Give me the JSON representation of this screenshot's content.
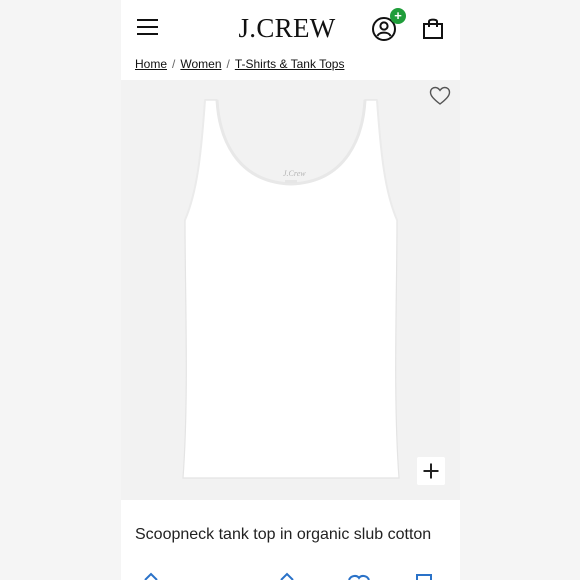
{
  "header": {
    "logo_text": "J.CREW",
    "menu_icon": "hamburger-menu-icon",
    "account_icon": "account-icon",
    "account_badge": "+",
    "bag_icon": "shopping-bag-icon",
    "badge_color": "#1f9d3a"
  },
  "breadcrumb": {
    "items": [
      "Home",
      "Women",
      "T-Shirts & Tank Tops"
    ],
    "separator": "/"
  },
  "gallery": {
    "wishlist_icon": "heart-icon",
    "zoom_icon": "plus-icon",
    "label_text": "J.Crew"
  },
  "product": {
    "title": "Scoopneck tank top in organic slub cotton"
  },
  "colors": {
    "page_background": "#f5f5f5",
    "gallery_background": "#f2f2f2",
    "icon_blue": "#2a72c8"
  }
}
